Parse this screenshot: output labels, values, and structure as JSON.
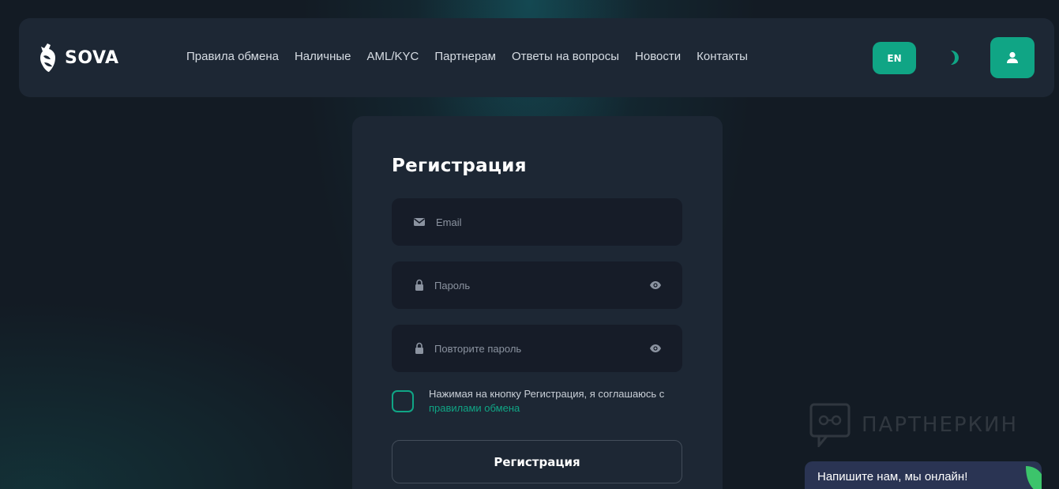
{
  "header": {
    "logo_text": "SOVA",
    "nav": [
      {
        "label": "Правила обмена"
      },
      {
        "label": "Наличные"
      },
      {
        "label": "AML/KYC"
      },
      {
        "label": "Партнерам"
      },
      {
        "label": "Ответы на вопросы"
      },
      {
        "label": "Новости"
      },
      {
        "label": "Контакты"
      }
    ],
    "lang_label": "EN",
    "theme_icon": "moon-icon",
    "user_icon": "user-icon"
  },
  "form": {
    "title": "Регистрация",
    "email_placeholder": "Email",
    "password_placeholder": "Пароль",
    "repeat_password_placeholder": "Повторите пароль",
    "consent_text": "Нажимая на кнопку Регистрация, я соглашаюсь с",
    "consent_link": "правилами обмена",
    "submit_label": "Регистрация"
  },
  "watermark": {
    "text": "ПАРТНЕРКИН"
  },
  "chat": {
    "label": "Напишите нам, мы онлайн!"
  },
  "colors": {
    "accent": "#10a585",
    "background": "#131b24",
    "panel": "#1d2734",
    "field": "#161c28",
    "chat": "#2a3453"
  }
}
